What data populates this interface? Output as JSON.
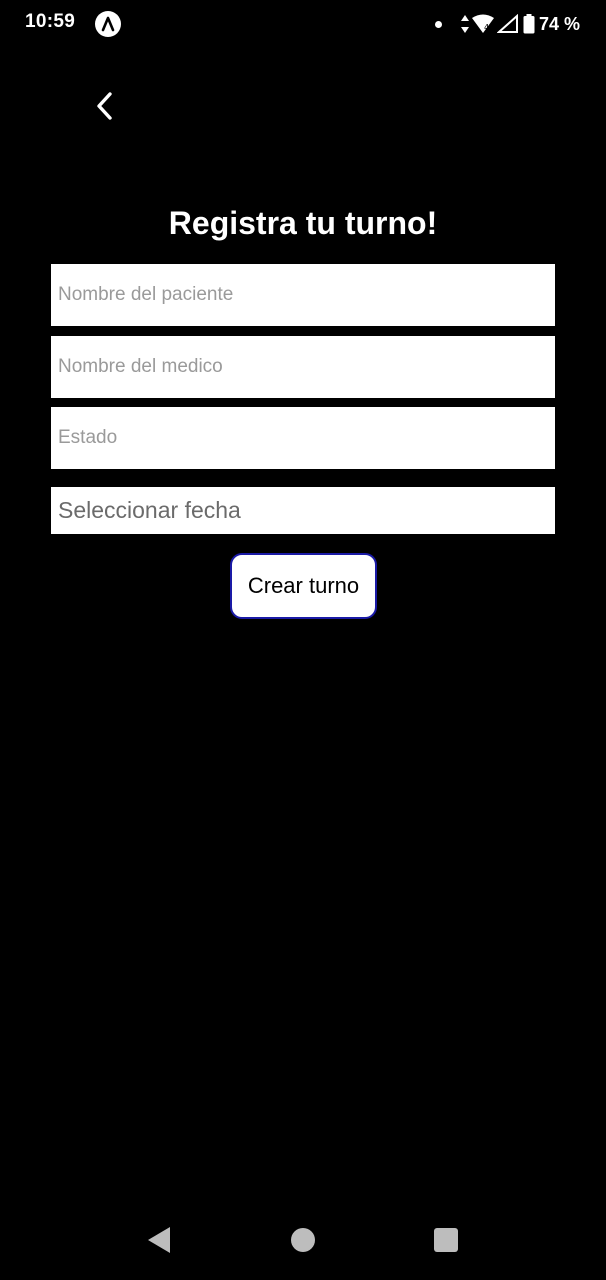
{
  "status_bar": {
    "time": "10:59",
    "battery_percent": "74 %",
    "icons": [
      "app-notification-icon",
      "dot-icon",
      "data-arrows-icon",
      "wifi-icon",
      "signal-icon",
      "battery-icon"
    ]
  },
  "header": {
    "back_icon": "chevron-left-icon"
  },
  "form": {
    "title": "Registra tu turno!",
    "patient_placeholder": "Nombre del paciente",
    "doctor_placeholder": "Nombre del medico",
    "state_placeholder": "Estado",
    "date_label": "Seleccionar fecha",
    "submit_label": "Crear turno"
  },
  "colors": {
    "background": "#000000",
    "field_background": "#ffffff",
    "button_border": "#1a1aa6",
    "placeholder": "#9a9a9a"
  },
  "nav_bar": {
    "icons": [
      "nav-back-icon",
      "nav-home-icon",
      "nav-recents-icon"
    ]
  }
}
